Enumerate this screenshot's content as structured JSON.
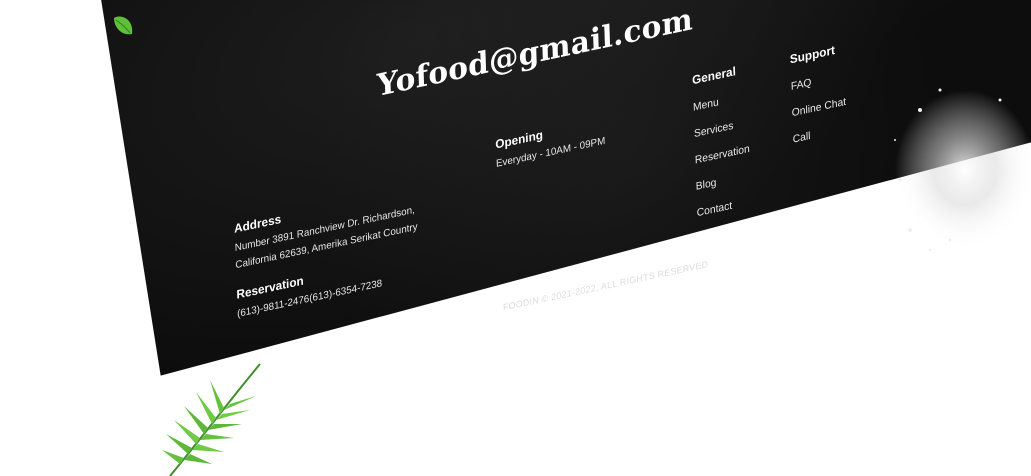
{
  "footer": {
    "email": "Yofood@gmail.com",
    "address": {
      "title": "Address",
      "line1": "Number 3891 Ranchview Dr. Richardson,",
      "line2": "California 62639, Amerika Serikat Country"
    },
    "reservation": {
      "title": "Reservation",
      "phones": "(613)-9811-2476(613)-6354-7238"
    },
    "opening": {
      "title": "Opening",
      "hours": "Everyday - 10AM - 09PM"
    },
    "general": {
      "title": "General",
      "items": [
        "Menu",
        "Services",
        "Reservation",
        "Blog",
        "Contact"
      ]
    },
    "support": {
      "title": "Support",
      "items": [
        "FAQ",
        "Online Chat",
        "Call"
      ]
    },
    "copyright": "FOODIN © 2021-2022, ALL RIGHTS RESERVED"
  },
  "icons": {
    "leaf": "leaf-icon",
    "fern": "fern-icon",
    "flour_dust": "flour-dust-decoration"
  },
  "colors": {
    "background": "#0d0d0d",
    "card": "#242424",
    "text": "#ffffff",
    "leaf_green": "#5fbf3a"
  }
}
